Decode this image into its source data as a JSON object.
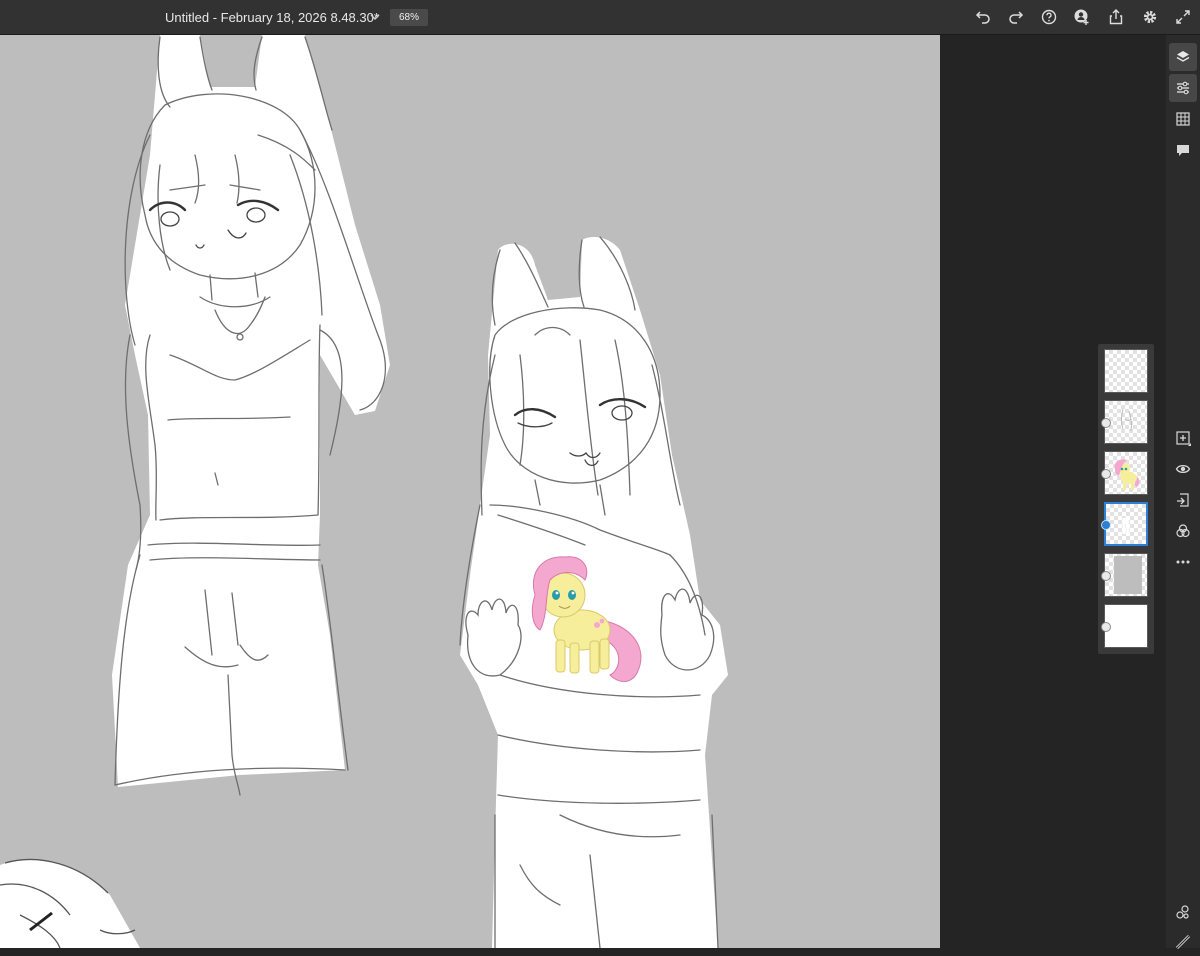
{
  "app": {
    "document_title": "Untitled - February 18, 2026 8.48.30*",
    "zoom": "68%"
  },
  "toolbar_right": [
    {
      "name": "undo-icon"
    },
    {
      "name": "redo-icon"
    },
    {
      "name": "help-icon"
    },
    {
      "name": "invite-user-icon"
    },
    {
      "name": "share-export-icon"
    },
    {
      "name": "settings-gear-icon"
    },
    {
      "name": "fullscreen-icon"
    }
  ],
  "right_rail": {
    "buttons": [
      {
        "name": "layers-panel-icon",
        "active": true
      },
      {
        "name": "layer-properties-icon",
        "active": true
      },
      {
        "name": "grid-icon",
        "active": false
      },
      {
        "name": "comments-icon",
        "active": false
      }
    ],
    "layer_actions": [
      {
        "name": "add-layer-icon"
      },
      {
        "name": "visibility-eye-icon"
      },
      {
        "name": "merge-down-icon"
      },
      {
        "name": "blend-mode-icon"
      },
      {
        "name": "more-options-icon"
      }
    ],
    "bottom_tools": [
      {
        "name": "shapes-icon"
      },
      {
        "name": "ruler-icon"
      }
    ]
  },
  "layers": [
    {
      "name": "layer-1",
      "content": "empty",
      "selected": false,
      "badge": false
    },
    {
      "name": "layer-2",
      "content": "sketch",
      "selected": false,
      "badge": true
    },
    {
      "name": "layer-3",
      "content": "pony-image",
      "selected": false,
      "badge": true
    },
    {
      "name": "layer-4",
      "content": "white-fill",
      "selected": true,
      "badge": true
    },
    {
      "name": "layer-5",
      "content": "gray-fill",
      "selected": false,
      "badge": true
    },
    {
      "name": "layer-6",
      "content": "white-background",
      "selected": false,
      "badge": true
    }
  ],
  "colors": {
    "canvas_bg": "#bdbdbd",
    "workspace_bg": "#242424",
    "topbar_bg": "#323232",
    "selection_accent": "#2d7fd6",
    "pony_body": "#f7ee9c",
    "pony_mane": "#f5a8cf"
  }
}
